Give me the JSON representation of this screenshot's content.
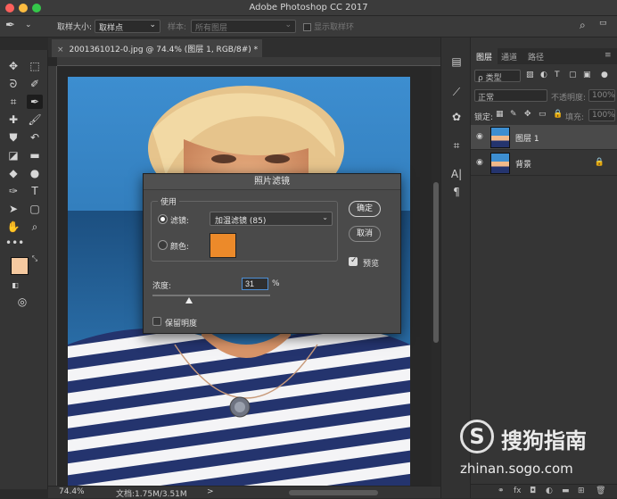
{
  "app": {
    "title": "Adobe Photoshop CC 2017"
  },
  "options_bar": {
    "sample_size_label": "取样大小:",
    "sample_size_value": "取样点",
    "sample_label": "样本:",
    "sample_value": "所有图层",
    "show_ring_label": "显示取样环"
  },
  "document": {
    "tab_title": "2001361012-0.jpg @ 74.4% (图层 1, RGB/8#) *",
    "close_glyph": "×"
  },
  "status_bar": {
    "zoom": "74.4%",
    "doc_info": "文档:1.75M/3.51M",
    "arrow": ">"
  },
  "colors": {
    "foreground": "#f5c9a0",
    "background": "#ffffff",
    "accent": "#4d8fd6",
    "filter_swatch": "#ec8a2a"
  },
  "layers_panel": {
    "tabs": [
      {
        "label": "图层"
      },
      {
        "label": "通道"
      },
      {
        "label": "路径"
      }
    ],
    "kind_filter": "ρ 类型",
    "blend_mode": "正常",
    "opacity_label": "不透明度:",
    "opacity_value": "100%",
    "lock_label": "锁定:",
    "fill_label": "填充:",
    "fill_value": "100%",
    "layers": [
      {
        "name": "图层 1",
        "selected": true,
        "locked": false
      },
      {
        "name": "背景",
        "selected": false,
        "locked": true
      }
    ],
    "footer_icons": [
      "link-icon",
      "fx-icon",
      "mask-icon",
      "adjustment-icon",
      "folder-icon",
      "new-layer-icon",
      "trash-icon"
    ]
  },
  "dialog": {
    "title": "照片滤镜",
    "group_label": "使用",
    "filter_option_label": "滤镜:",
    "filter_value": "加温滤镜 (85)",
    "color_option_label": "颜色:",
    "density_label": "浓度:",
    "density_value": "31",
    "density_unit": "%",
    "density_fraction": 0.31,
    "preserve_luminosity_label": "保留明度",
    "ok_label": "确定",
    "cancel_label": "取消",
    "preview_label": "预览",
    "preview_checked": true,
    "preserve_checked": false
  },
  "watermark": {
    "brand": "搜狗指南",
    "url": "zhinan.sogo.com"
  }
}
